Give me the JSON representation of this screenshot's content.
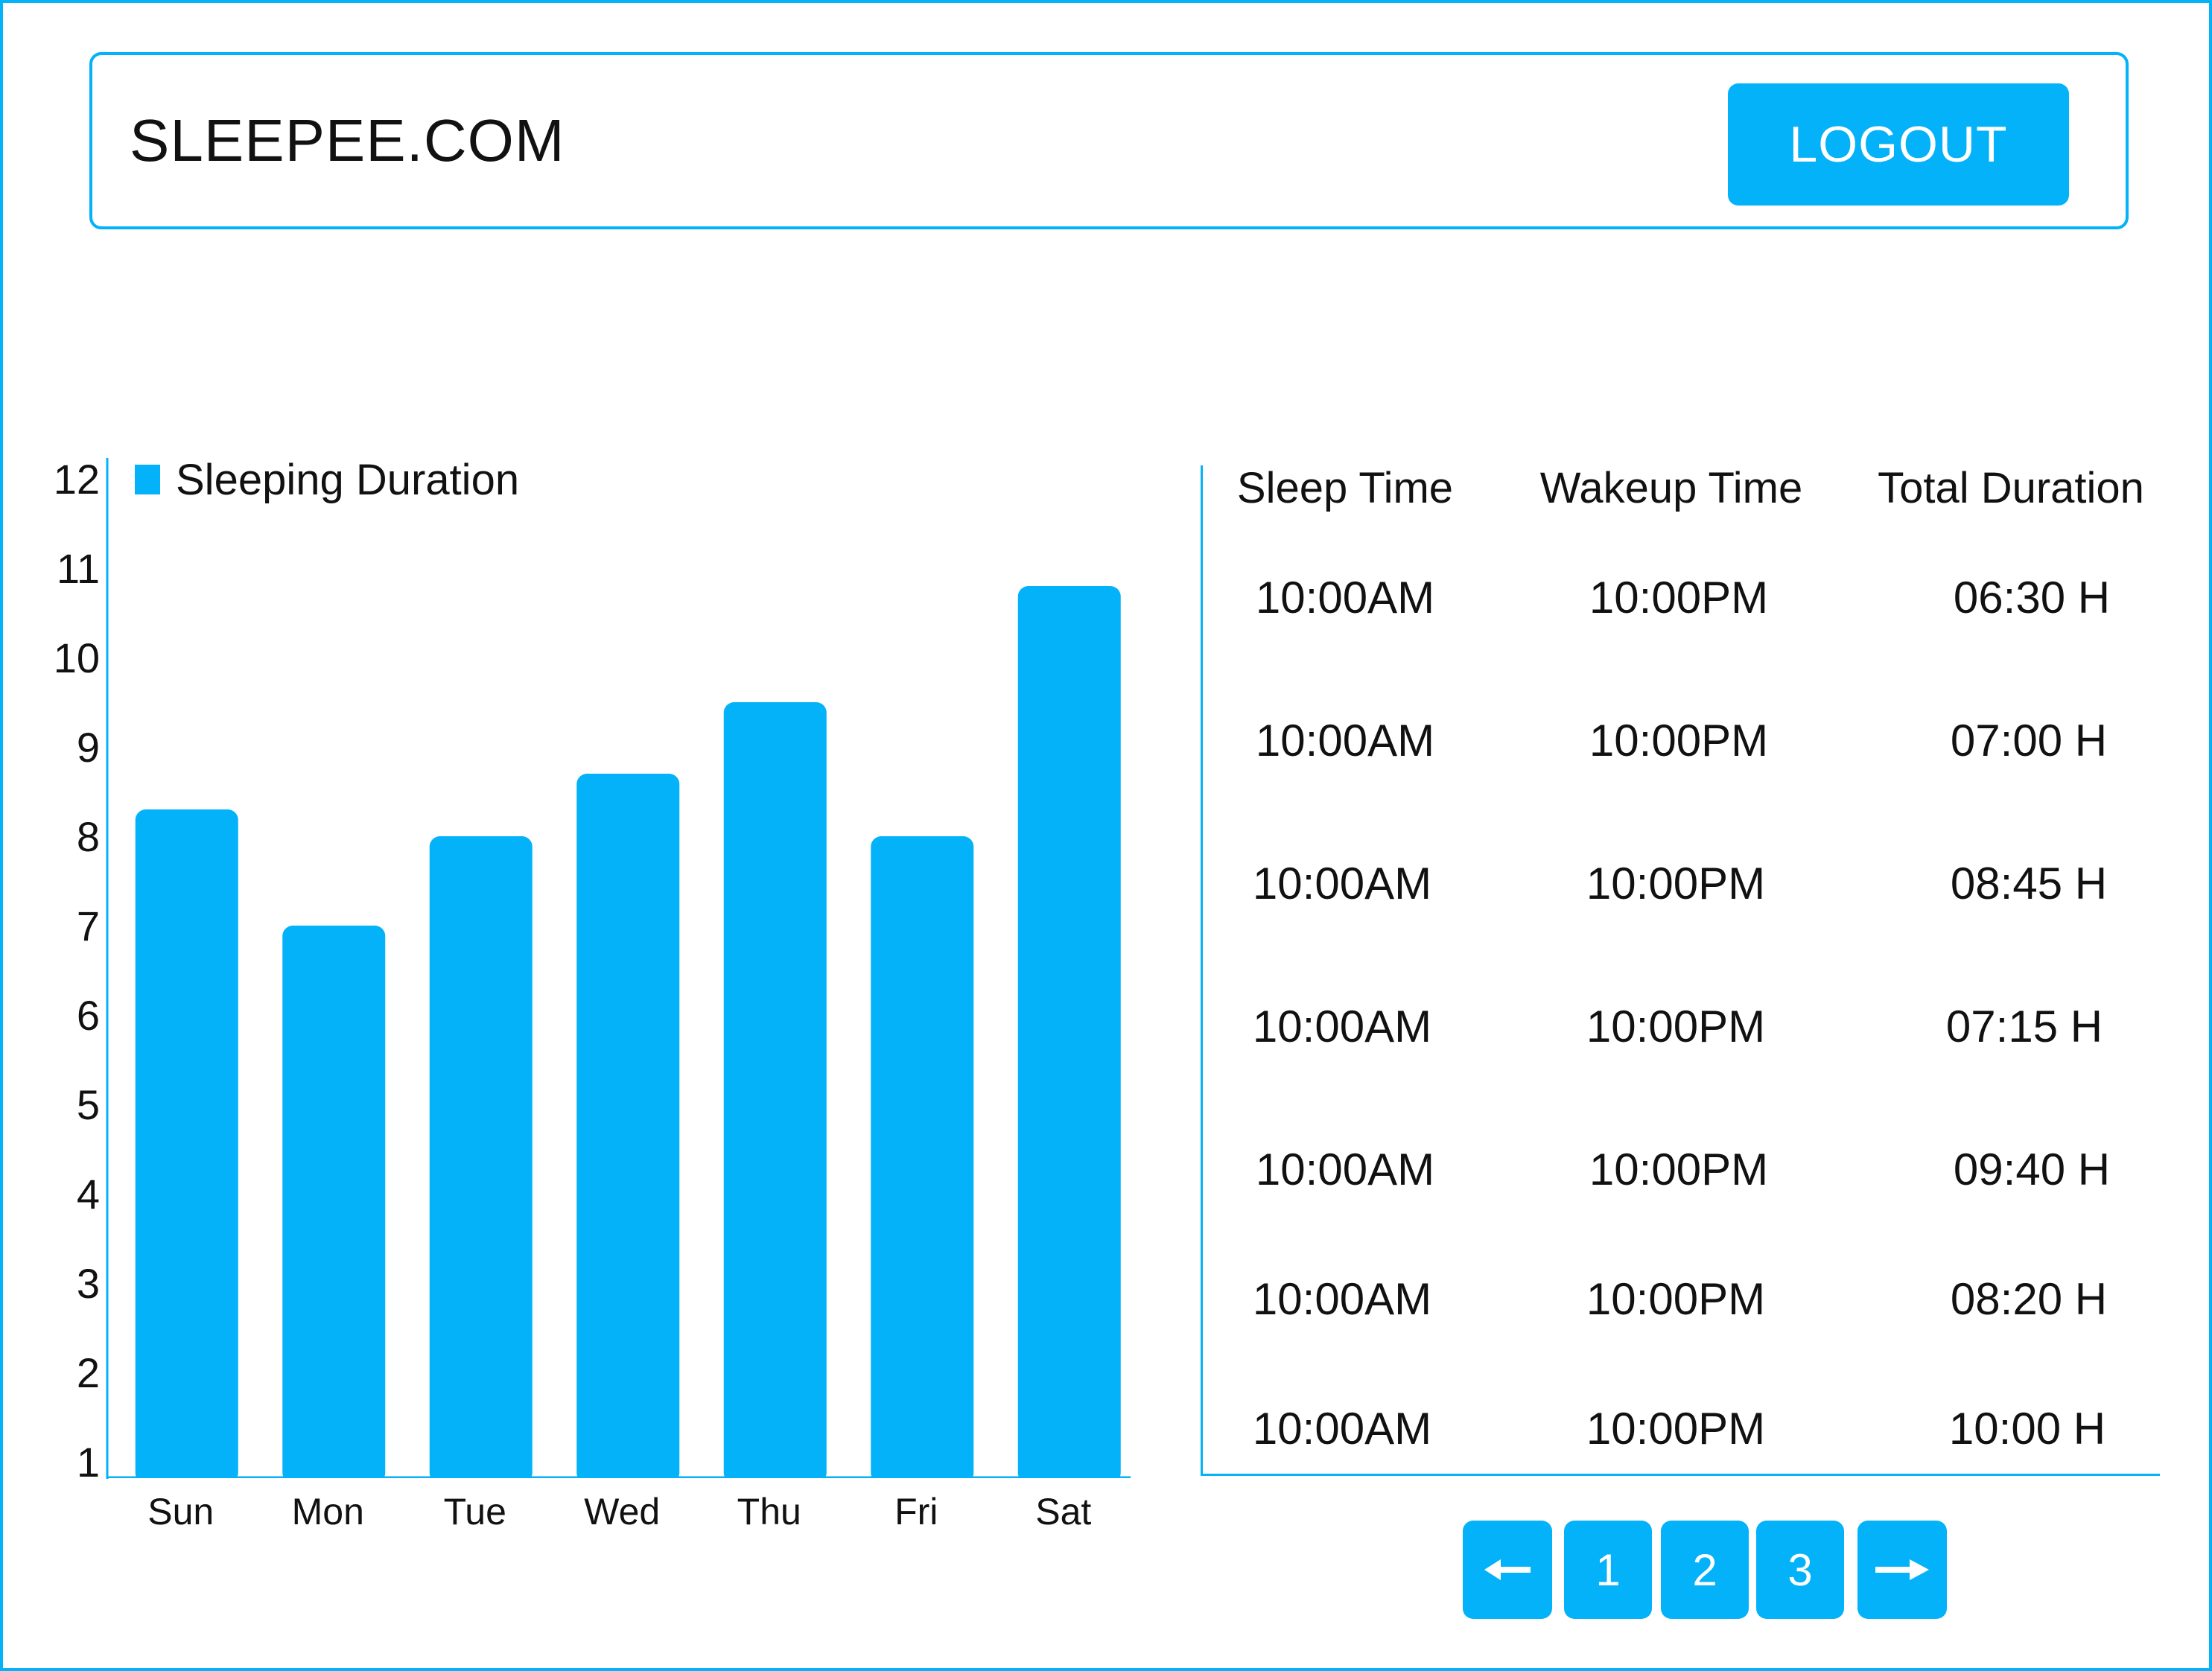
{
  "header": {
    "brand": "SLEEPEE.COM",
    "logout_label": "LOGOUT"
  },
  "colors": {
    "accent": "#03b2f9",
    "text": "#111111",
    "background": "#ffffff"
  },
  "chart_data": {
    "type": "bar",
    "categories": [
      "Sun",
      "Mon",
      "Tue",
      "Wed",
      "Thu",
      "Fri",
      "Sat"
    ],
    "series": [
      {
        "name": "Sleeping Duration",
        "values": [
          8.3,
          7.0,
          8.0,
          8.7,
          9.5,
          8.0,
          10.8
        ]
      }
    ],
    "ylim": [
      1,
      12
    ],
    "yticks": [
      1,
      2,
      3,
      4,
      5,
      6,
      7,
      8,
      9,
      10,
      11,
      12
    ],
    "legend_position": "top-left",
    "grid": false
  },
  "table": {
    "columns": [
      "Sleep Time",
      "Wakeup Time",
      "Total Duration"
    ],
    "rows": [
      [
        "10:00AM",
        "10:00PM",
        "06:30 H"
      ],
      [
        "10:00AM",
        "10:00PM",
        "07:00 H"
      ],
      [
        "10:00AM",
        "10:00PM",
        "08:45 H"
      ],
      [
        "10:00AM",
        "10:00PM",
        "07:15 H"
      ],
      [
        "10:00AM",
        "10:00PM",
        "09:40 H"
      ],
      [
        "10:00AM",
        "10:00PM",
        "08:20 H"
      ],
      [
        "10:00AM",
        "10:00PM",
        "10:00 H"
      ]
    ]
  },
  "pagination": {
    "prev_icon": "arrow-left-icon",
    "next_icon": "arrow-right-icon",
    "pages": [
      "1",
      "2",
      "3"
    ]
  }
}
